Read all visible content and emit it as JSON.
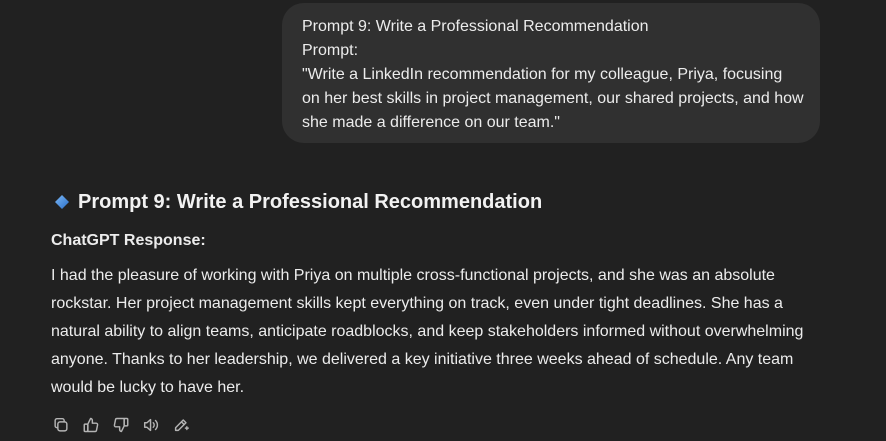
{
  "user_message": {
    "line1": "Prompt 9: Write a Professional Recommendation",
    "line2": "Prompt:",
    "line3": "\"Write a LinkedIn recommendation for my colleague, Priya, focusing on her best skills in project management, our shared projects, and how she made a difference on our team.\""
  },
  "assistant_message": {
    "heading_icon": "blue-diamond-icon",
    "heading": "Prompt 9: Write a Professional Recommendation",
    "subheading": "ChatGPT Response:",
    "body": "I had the pleasure of working with Priya on multiple cross-functional projects, and she was an absolute rockstar. Her project management skills kept everything on track, even under tight deadlines. She has a natural ability to align teams, anticipate roadblocks, and keep stakeholders informed without overwhelming anyone. Thanks to her leadership, we delivered a key initiative three weeks ahead of schedule. Any team would be lucky to have her."
  },
  "actions": [
    {
      "icon": "copy-icon"
    },
    {
      "icon": "thumbs-up-icon"
    },
    {
      "icon": "thumbs-down-icon"
    },
    {
      "icon": "read-aloud-icon"
    },
    {
      "icon": "edit-icon"
    }
  ],
  "colors": {
    "background": "#212121",
    "bubble": "#303030",
    "text": "#ececec",
    "icon": "#b4b4b4",
    "diamond": "#3d8be0"
  }
}
